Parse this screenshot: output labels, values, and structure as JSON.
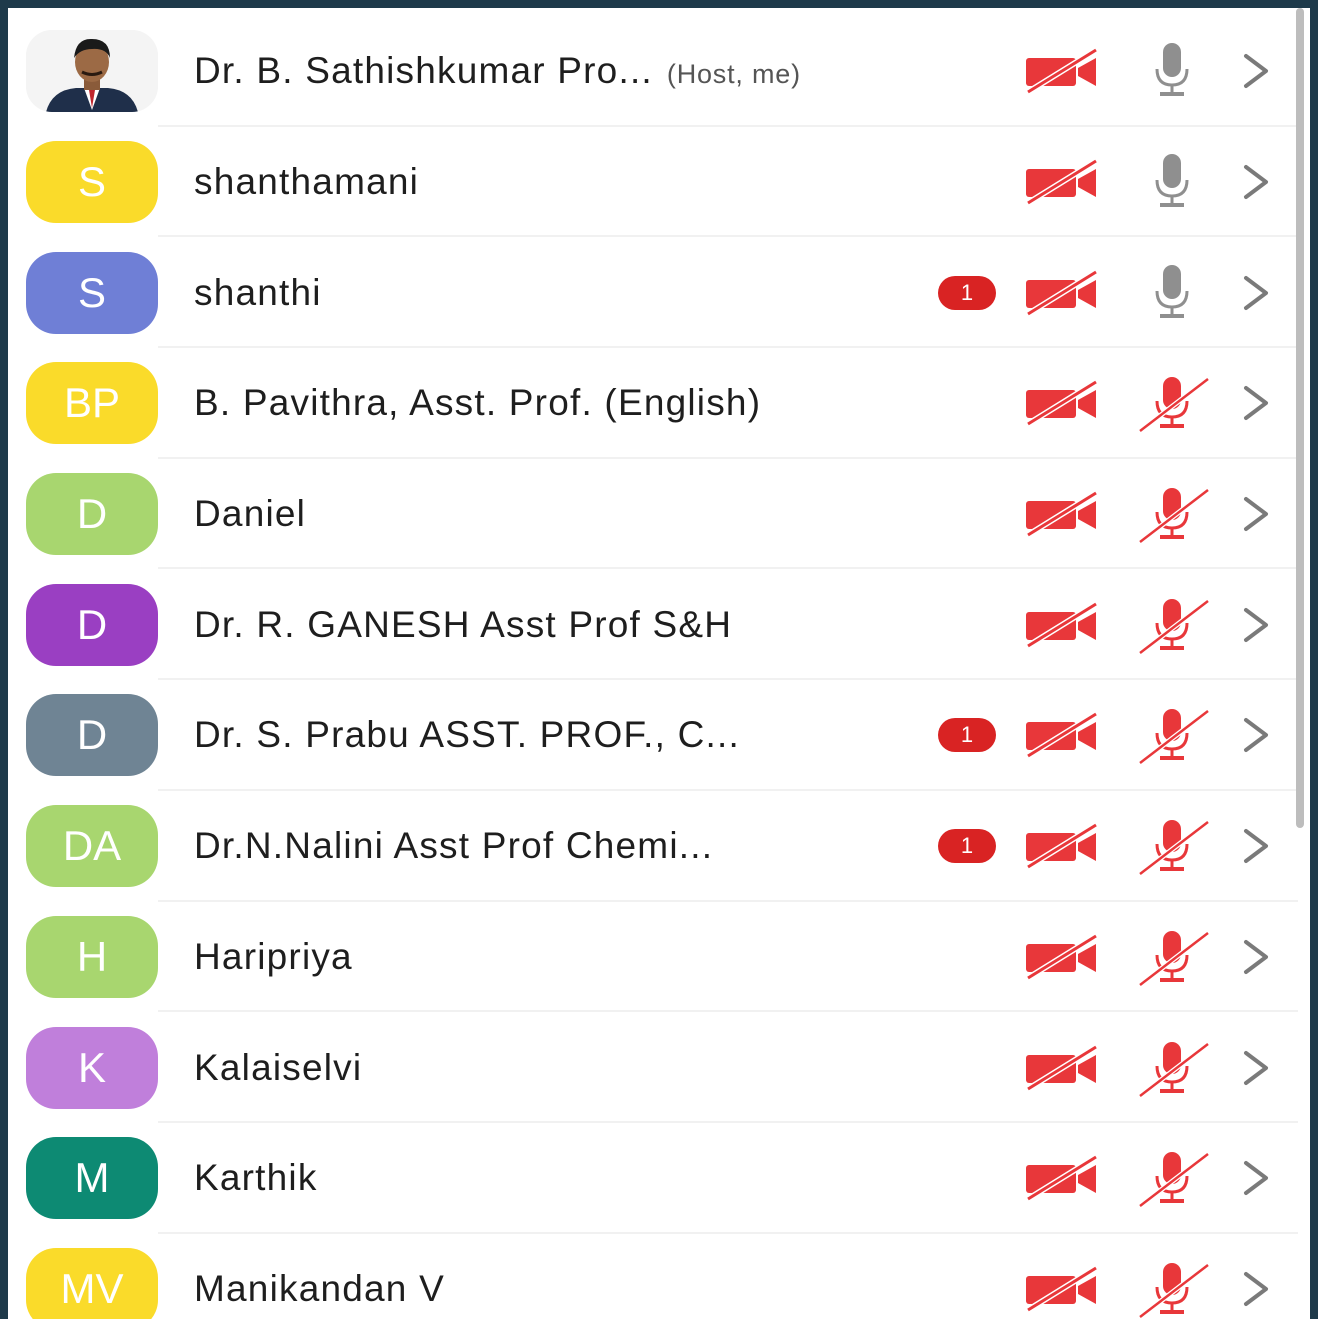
{
  "participants": [
    {
      "name": "Dr. B. Sathishkumar Pro...",
      "tag": "(Host, me)",
      "avatar_text": "",
      "avatar_color": "#f4f4f4",
      "photo": true,
      "badge": "",
      "mic": "on"
    },
    {
      "name": "shanthamani",
      "tag": "",
      "avatar_text": "S",
      "avatar_color": "#fadb2a",
      "photo": false,
      "badge": "",
      "mic": "on"
    },
    {
      "name": "shanthi",
      "tag": "",
      "avatar_text": "S",
      "avatar_color": "#6f7fd6",
      "photo": false,
      "badge": "1",
      "mic": "on"
    },
    {
      "name": "B. Pavithra, Asst. Prof. (English)",
      "tag": "",
      "avatar_text": "BP",
      "avatar_color": "#fadb2a",
      "photo": false,
      "badge": "",
      "mic": "off"
    },
    {
      "name": "Daniel",
      "tag": "",
      "avatar_text": "D",
      "avatar_color": "#a8d66f",
      "photo": false,
      "badge": "",
      "mic": "off"
    },
    {
      "name": "Dr. R. GANESH Asst Prof S&H",
      "tag": "",
      "avatar_text": "D",
      "avatar_color": "#9a3fc2",
      "photo": false,
      "badge": "",
      "mic": "off"
    },
    {
      "name": "Dr. S. Prabu ASST. PROF., C...",
      "tag": "",
      "avatar_text": "D",
      "avatar_color": "#6f8494",
      "photo": false,
      "badge": "1",
      "mic": "off"
    },
    {
      "name": "Dr.N.Nalini Asst Prof Chemi...",
      "tag": "",
      "avatar_text": "DA",
      "avatar_color": "#a8d66f",
      "photo": false,
      "badge": "1",
      "mic": "off"
    },
    {
      "name": "Haripriya",
      "tag": "",
      "avatar_text": "H",
      "avatar_color": "#a8d66f",
      "photo": false,
      "badge": "",
      "mic": "off"
    },
    {
      "name": "Kalaiselvi",
      "tag": "",
      "avatar_text": "K",
      "avatar_color": "#c07fdb",
      "photo": false,
      "badge": "",
      "mic": "off"
    },
    {
      "name": "Karthik",
      "tag": "",
      "avatar_text": "M",
      "avatar_color": "#0d8a73",
      "photo": false,
      "badge": "",
      "mic": "off"
    },
    {
      "name": "Manikandan V",
      "tag": "",
      "avatar_text": "MV",
      "avatar_color": "#fadb2a",
      "photo": false,
      "badge": "",
      "mic": "off"
    }
  ],
  "colors": {
    "muted_red": "#e8373a",
    "mic_on_gray": "#8f8f8f",
    "badge_red": "#d92323",
    "chevron": "#7a7a7a"
  },
  "icons": {
    "camera": "video-off-icon",
    "mic_on": "mic-icon",
    "mic_off": "mic-off-icon",
    "chevron": "chevron-right-icon"
  }
}
